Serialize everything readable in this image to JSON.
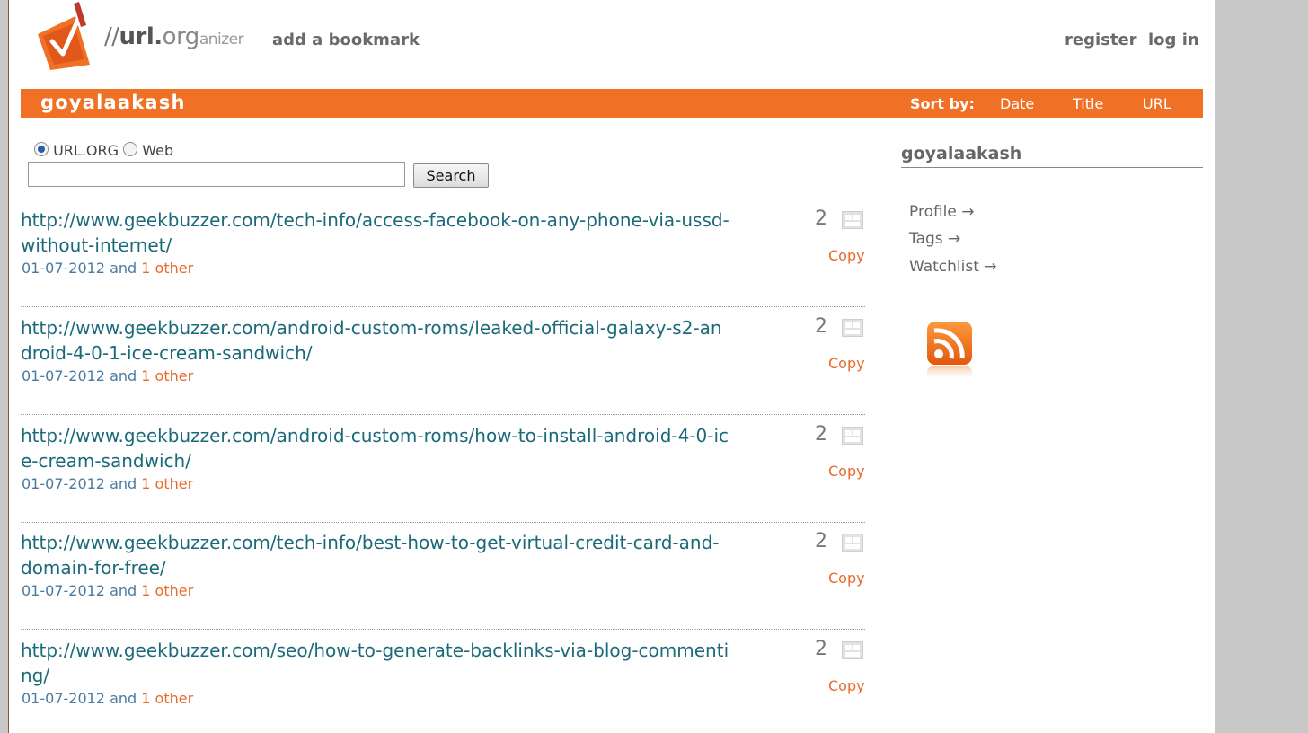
{
  "header": {
    "logo_text_prefix": "//",
    "logo_text_url": "url.",
    "logo_text_org": "org",
    "logo_text_suffix": "anizer",
    "add_bookmark": "add a bookmark",
    "register": "register",
    "login": "log in"
  },
  "bar": {
    "username": "goyalaakash",
    "sort_label": "Sort by:",
    "sort_options": [
      "Date",
      "Title",
      "URL"
    ]
  },
  "search": {
    "option_urlorg": "URL.ORG",
    "option_web": "Web",
    "selected": "URL.ORG",
    "input_value": "",
    "button_label": "Search"
  },
  "bookmarks": [
    {
      "url": "http://www.geekbuzzer.com/tech-info/access-facebook-on-any-phone-via-ussd-without-internet/",
      "date": "01-07-2012",
      "and": "and",
      "others": "1 other",
      "count": "2",
      "copy": "Copy"
    },
    {
      "url": "http://www.geekbuzzer.com/android-custom-roms/leaked-official-galaxy-s2-android-4-0-1-ice-cream-sandwich/",
      "date": "01-07-2012",
      "and": "and",
      "others": "1 other",
      "count": "2",
      "copy": "Copy"
    },
    {
      "url": "http://www.geekbuzzer.com/android-custom-roms/how-to-install-android-4-0-ice-cream-sandwich/",
      "date": "01-07-2012",
      "and": "and",
      "others": "1 other",
      "count": "2",
      "copy": "Copy"
    },
    {
      "url": "http://www.geekbuzzer.com/tech-info/best-how-to-get-virtual-credit-card-and-domain-for-free/",
      "date": "01-07-2012",
      "and": "and",
      "others": "1 other",
      "count": "2",
      "copy": "Copy"
    },
    {
      "url": "http://www.geekbuzzer.com/seo/how-to-generate-backlinks-via-blog-commenting/",
      "date": "01-07-2012",
      "and": "and",
      "others": "1 other",
      "count": "2",
      "copy": "Copy"
    }
  ],
  "sidebar": {
    "title": "goyalaakash",
    "links": [
      "Profile →",
      "Tags →",
      "Watchlist →"
    ],
    "rss_icon": "rss-feed-icon"
  },
  "colors": {
    "accent_orange": "#f07025",
    "link_teal": "#1b6a7a",
    "meta_blue": "#4a7aa0"
  }
}
